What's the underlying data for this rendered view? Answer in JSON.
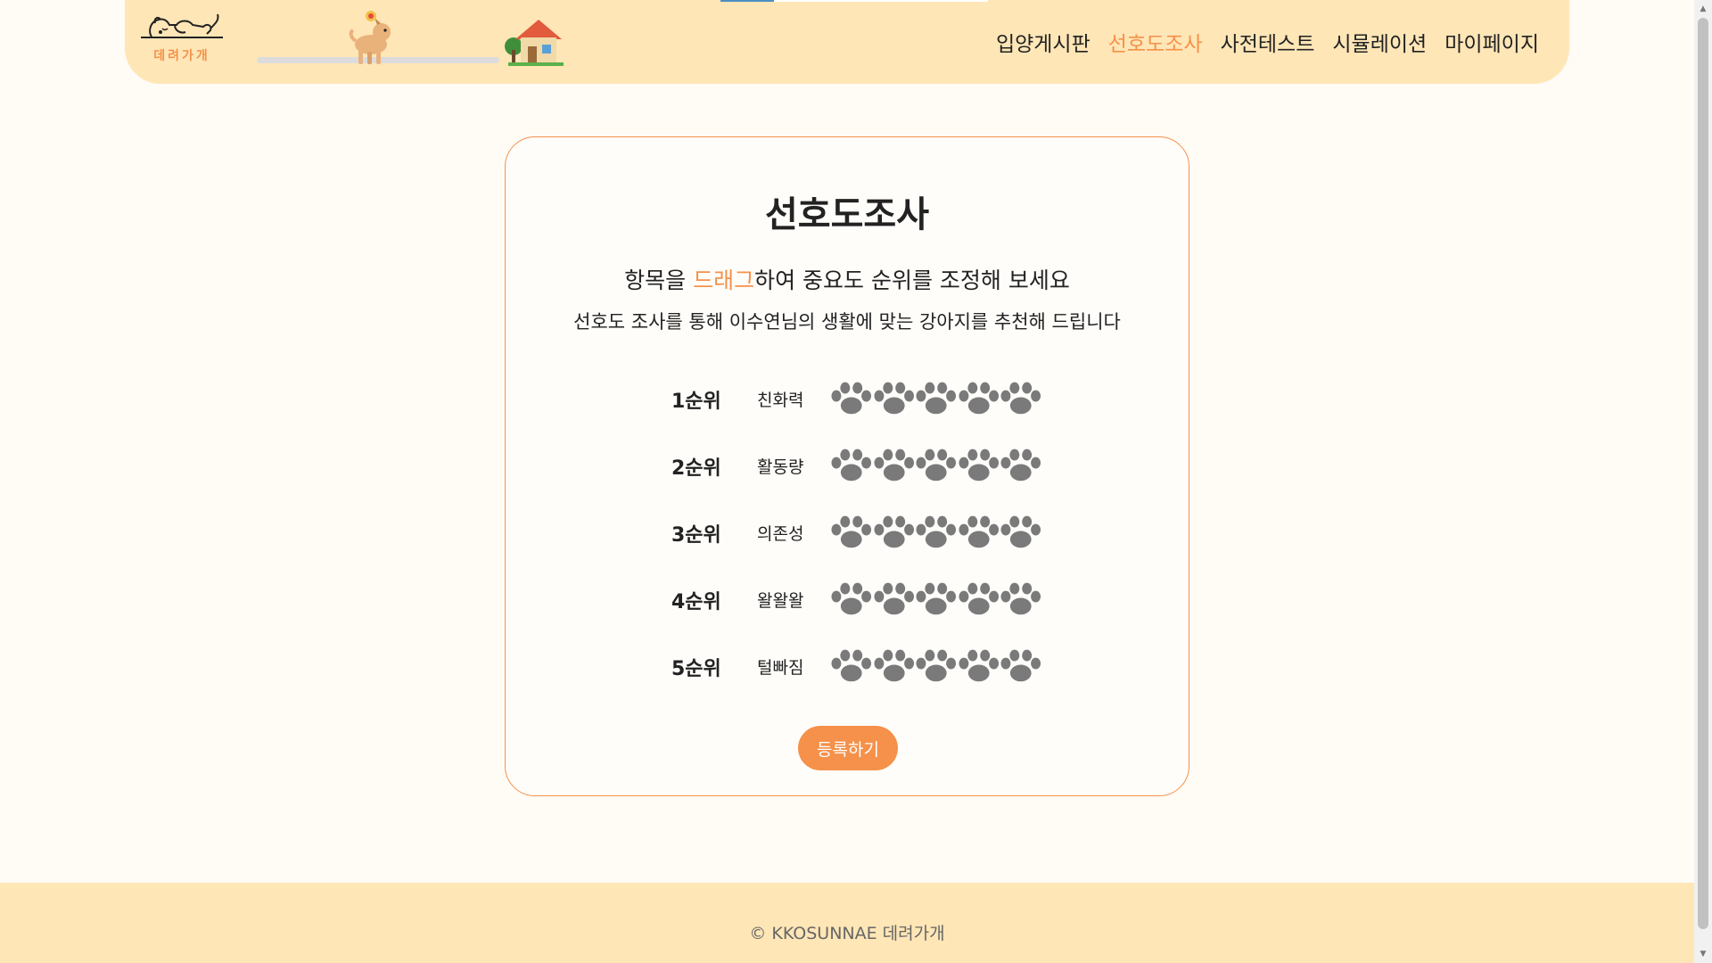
{
  "header": {
    "logo_text": "데려가개",
    "nav": [
      {
        "label": "입양게시판",
        "active": false
      },
      {
        "label": "선호도조사",
        "active": true
      },
      {
        "label": "사전테스트",
        "active": false
      },
      {
        "label": "시뮬레이션",
        "active": false
      },
      {
        "label": "마이페이지",
        "active": false
      }
    ]
  },
  "card": {
    "title": "선호도조사",
    "subtitle_prefix": "항목을 ",
    "subtitle_highlight": "드래그",
    "subtitle_suffix": "하여 중요도 순위를 조정해 보세요",
    "description": "선호도 조사를 통해 이수연님의 생활에 맞는 강아지를 추천해 드립니다",
    "ranks": [
      {
        "rank": "1순위",
        "item": "친화력"
      },
      {
        "rank": "2순위",
        "item": "활동량"
      },
      {
        "rank": "3순위",
        "item": "의존성"
      },
      {
        "rank": "4순위",
        "item": "왈왈왈"
      },
      {
        "rank": "5순위",
        "item": "털빠짐"
      }
    ],
    "submit_label": "등록하기"
  },
  "footer": {
    "copyright": "© KKOSUNNAE 데려가개"
  },
  "colors": {
    "accent": "#f5914a",
    "header_bg": "#ffe6b6",
    "page_bg": "#fffbf5",
    "paw": "#7a7a7a"
  },
  "icons": {
    "logo": "sleeping-dog-icon",
    "progress_dog": "walking-dog-icon",
    "progress_home": "house-icon",
    "rating": "paw-icon"
  }
}
